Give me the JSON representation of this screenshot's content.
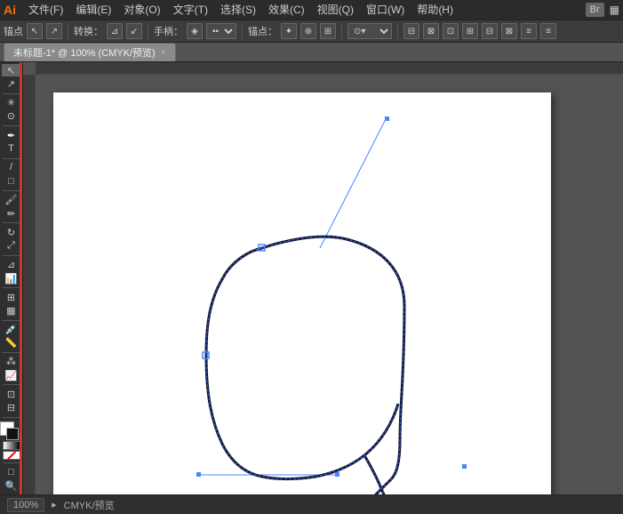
{
  "app": {
    "logo": "Ai",
    "br_label": "Br"
  },
  "menubar": {
    "items": [
      {
        "label": "文件(F)"
      },
      {
        "label": "编辑(E)"
      },
      {
        "label": "对象(O)"
      },
      {
        "label": "文字(T)"
      },
      {
        "label": "选择(S)"
      },
      {
        "label": "效果(C)"
      },
      {
        "label": "视图(Q)"
      },
      {
        "label": "窗口(W)"
      },
      {
        "label": "帮助(H)"
      }
    ]
  },
  "toolbar": {
    "anchor_label": "锚点",
    "transform_label": "转换：",
    "handle_label": "手柄：",
    "anchor_point_label": "锚点："
  },
  "tab": {
    "title": "未标题-1* @ 100% (CMYK/预览)",
    "close": "×"
  },
  "statusbar": {
    "zoom": "100%",
    "mode": "CMYK/预览"
  },
  "canvas": {
    "bg": "#ffffff"
  }
}
